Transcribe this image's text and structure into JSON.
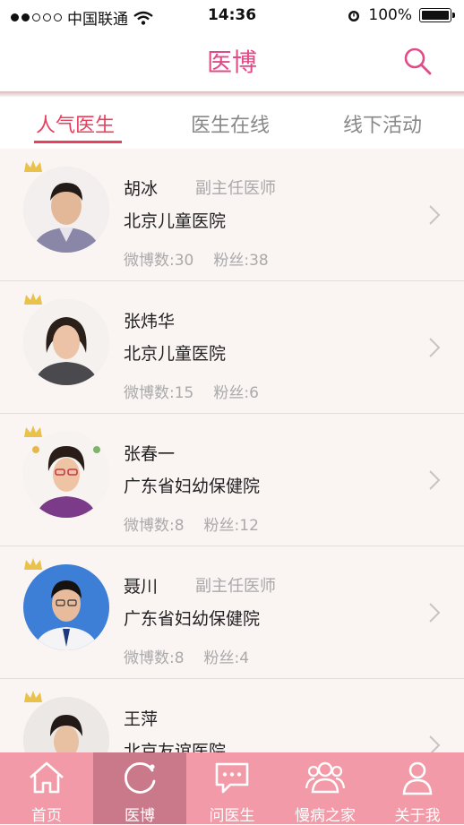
{
  "status_bar": {
    "carrier": "中国联通",
    "time": "14:36",
    "battery": "100%"
  },
  "header": {
    "title": "医博"
  },
  "tabs": [
    {
      "label": "人气医生",
      "active": true
    },
    {
      "label": "医生在线",
      "active": false
    },
    {
      "label": "线下活动",
      "active": false
    }
  ],
  "doctors": [
    {
      "name": "胡冰",
      "title": "副主任医师",
      "hospital": "北京儿童医院",
      "weibo": "微博数:30",
      "fans": "粉丝:38"
    },
    {
      "name": "张炜华",
      "title": "",
      "hospital": "北京儿童医院",
      "weibo": "微博数:15",
      "fans": "粉丝:6"
    },
    {
      "name": "张春一",
      "title": "",
      "hospital": "广东省妇幼保健院",
      "weibo": "微博数:8",
      "fans": "粉丝:12"
    },
    {
      "name": "聂川",
      "title": "副主任医师",
      "hospital": "广东省妇幼保健院",
      "weibo": "微博数:8",
      "fans": "粉丝:4"
    },
    {
      "name": "王萍",
      "title": "",
      "hospital": "北京友谊医院",
      "weibo": "",
      "fans": ""
    }
  ],
  "tabbar": [
    {
      "label": "首页",
      "icon": "home-icon"
    },
    {
      "label": "医博",
      "icon": "refresh-icon",
      "active": true
    },
    {
      "label": "问医生",
      "icon": "chat-icon"
    },
    {
      "label": "慢病之家",
      "icon": "group-icon"
    },
    {
      "label": "关于我",
      "icon": "person-icon"
    }
  ],
  "colors": {
    "accent": "#e14b87",
    "tab_active": "#e8405f",
    "tabbar_bg": "#f39aa8",
    "tabbar_active": "#c9798a"
  }
}
